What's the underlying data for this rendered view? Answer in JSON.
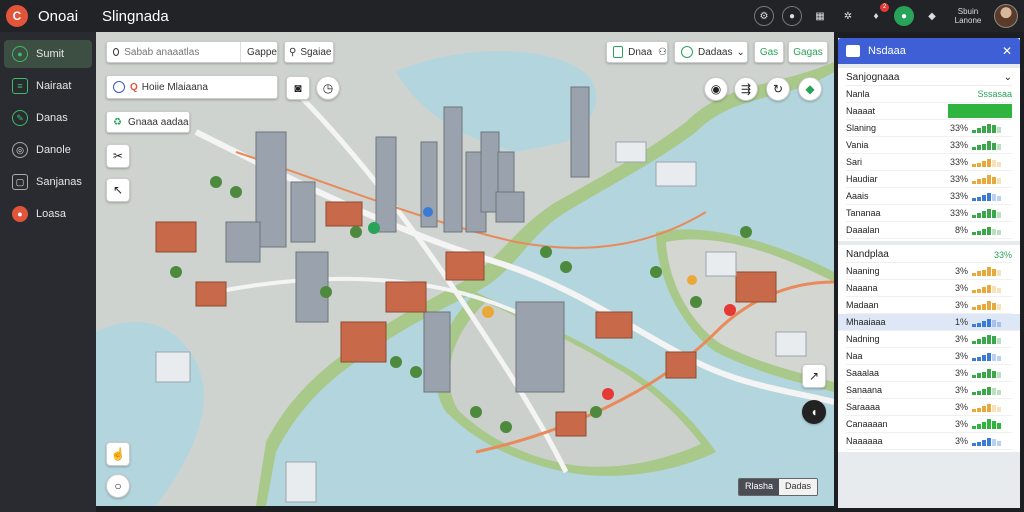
{
  "app": {
    "name": "Onoai",
    "title": "Slingnada"
  },
  "topbar": {
    "notification_count": "2",
    "user_lines": [
      "Sbuin",
      "Lanone"
    ]
  },
  "sidebar": {
    "items": [
      {
        "label": "Sumit",
        "icon": "pin-icon",
        "active": true
      },
      {
        "label": "Nairaat",
        "icon": "list-icon",
        "active": false
      },
      {
        "label": "Danas",
        "icon": "leaf-icon",
        "active": false
      },
      {
        "label": "Danole",
        "icon": "compass-icon",
        "active": false
      },
      {
        "label": "Sanjanas",
        "icon": "clock-icon",
        "active": false
      },
      {
        "label": "Loasa",
        "icon": "globe-icon",
        "active": false
      }
    ]
  },
  "map": {
    "search_placeholder": "Sabab anaaatlas",
    "search_button": "Gappe",
    "search2_label": "Sgaiae",
    "place_label": "Hoiie Mlaiaana",
    "layer_label": "Gnaaa aadaa",
    "top_controls": [
      "Dnaa",
      "Dadaas",
      "Gas",
      "Gagas"
    ],
    "scale_labels": [
      "Rlasha",
      "Dadas"
    ]
  },
  "panel": {
    "title": "Nsdaaa",
    "section_title": "Sanjognaaa",
    "header_left": "Nanla",
    "header_right": "Sssasaa",
    "summary_label": "Naaaat",
    "rows1": [
      {
        "label": "Slaning",
        "value": "33%",
        "bar_color": "#3aa84a",
        "level": 0.8
      },
      {
        "label": "Vania",
        "value": "33%",
        "bar_color": "#3aa84a",
        "level": 0.7
      },
      {
        "label": "Sari",
        "value": "33%",
        "bar_color": "#e8a93a",
        "level": 0.6
      },
      {
        "label": "Haudiar",
        "value": "33%",
        "bar_color": "#e8a93a",
        "level": 0.7
      },
      {
        "label": "Aaais",
        "value": "33%",
        "bar_color": "#3b7bd6",
        "level": 0.6
      },
      {
        "label": "Tananaa",
        "value": "33%",
        "bar_color": "#3aa84a",
        "level": 0.8
      },
      {
        "label": "Daaalan",
        "value": "8%",
        "bar_color": "#3aa84a",
        "level": 0.5
      }
    ],
    "section2_title": "Nandplaa",
    "section2_value": "33%",
    "rows2": [
      {
        "label": "Naaning",
        "value": "3%",
        "bar_color": "#e8a93a",
        "level": 0.7
      },
      {
        "label": "Naaana",
        "value": "3%",
        "bar_color": "#e8a93a",
        "level": 0.6
      },
      {
        "label": "Madaan",
        "value": "3%",
        "bar_color": "#e8a93a",
        "level": 0.7
      },
      {
        "label": "Mhaaiaaa",
        "value": "1%",
        "bar_color": "#3b7bd6",
        "level": 0.6,
        "highlight": true
      },
      {
        "label": "Nadning",
        "value": "3%",
        "bar_color": "#3aa84a",
        "level": 0.8
      },
      {
        "label": "Naa",
        "value": "3%",
        "bar_color": "#3b7bd6",
        "level": 0.6
      },
      {
        "label": "Saaalaa",
        "value": "3%",
        "bar_color": "#3aa84a",
        "level": 0.7
      },
      {
        "label": "Sanaana",
        "value": "3%",
        "bar_color": "#3aa84a",
        "level": 0.6
      },
      {
        "label": "Saraaaa",
        "value": "3%",
        "bar_color": "#e8a93a",
        "level": 0.6
      },
      {
        "label": "Canaaaan",
        "value": "3%",
        "bar_color": "#2fb43f",
        "level": 0.9
      },
      {
        "label": "Naaaaaa",
        "value": "3%",
        "bar_color": "#3b7bd6",
        "level": 0.6
      }
    ]
  }
}
